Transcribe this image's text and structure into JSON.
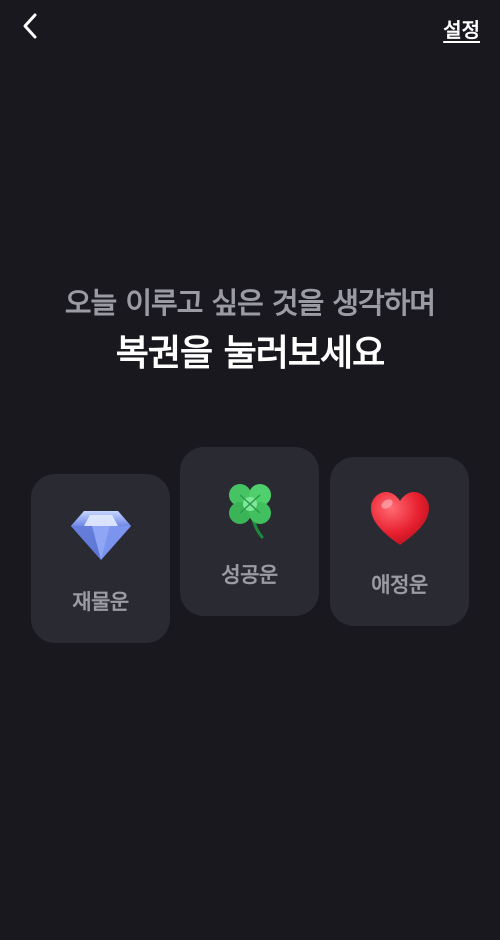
{
  "header": {
    "back_icon": "chevron-left-icon",
    "settings_label": "설정"
  },
  "main": {
    "subtitle": "오늘 이루고 싶은 것을 생각하며",
    "title": "복권을 눌러보세요"
  },
  "cards": [
    {
      "id": "wealth",
      "label": "재물운",
      "icon": "diamond-icon"
    },
    {
      "id": "success",
      "label": "성공운",
      "icon": "four-leaf-clover-icon"
    },
    {
      "id": "love",
      "label": "애정운",
      "icon": "heart-icon"
    }
  ],
  "colors": {
    "background": "#18181e",
    "card_background": "#2a2a33",
    "subtitle_text": "#9b9ba4",
    "title_text": "#ffffff",
    "heart_red": "#e8202f",
    "clover_green": "#3fbf5a",
    "diamond_blue": "#7e9bf0"
  }
}
